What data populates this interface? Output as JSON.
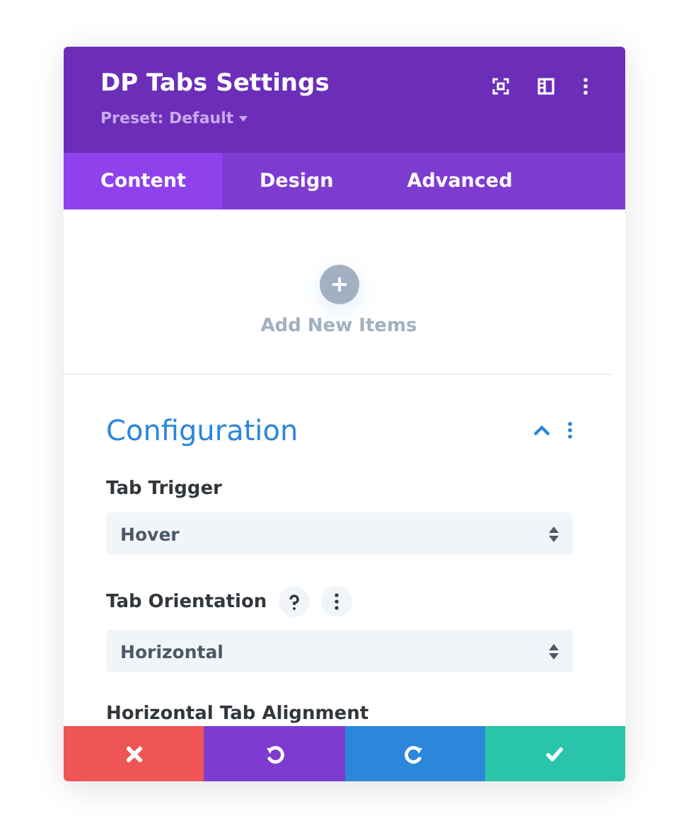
{
  "window": {
    "title": "DP Tabs Settings",
    "preset": "Preset: Default"
  },
  "tabs": [
    {
      "label": "Content",
      "selected": true
    },
    {
      "label": "Design",
      "selected": false
    },
    {
      "label": "Advanced",
      "selected": false
    }
  ],
  "add_items": {
    "label": "Add New Items"
  },
  "section": {
    "title": "Configuration",
    "expanded": true,
    "fields": [
      {
        "label": "Tab Trigger",
        "value": "Hover",
        "help": false
      },
      {
        "label": "Tab Orientation",
        "value": "Horizontal",
        "help": true
      },
      {
        "label": "Horizontal Tab Alignment",
        "help": false
      }
    ]
  },
  "footer": [
    {
      "kind": "cancel"
    },
    {
      "kind": "undo"
    },
    {
      "kind": "redo"
    },
    {
      "kind": "save"
    }
  ]
}
